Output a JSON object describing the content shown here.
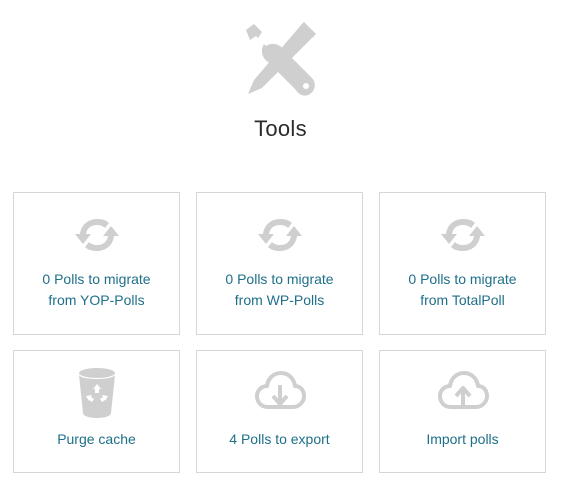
{
  "header": {
    "icon": "tools-icon",
    "title": "Tools"
  },
  "cards": [
    {
      "icon": "sync-icon",
      "line1": "0 Polls to migrate",
      "line2": "from YOP-Polls"
    },
    {
      "icon": "sync-icon",
      "line1": "0 Polls to migrate",
      "line2": "from WP-Polls"
    },
    {
      "icon": "sync-icon",
      "line1": "0 Polls to migrate",
      "line2": "from TotalPoll"
    },
    {
      "icon": "recycle-bin-icon",
      "line1": "Purge cache"
    },
    {
      "icon": "cloud-download-icon",
      "line1": "4 Polls to export"
    },
    {
      "icon": "cloud-upload-icon",
      "line1": "Import polls"
    }
  ],
  "colors": {
    "icon_gray": "#cfcfcf",
    "link_teal": "#1e6f8a",
    "title_dark": "#2b2b2b",
    "card_border": "#d6d6d6"
  }
}
